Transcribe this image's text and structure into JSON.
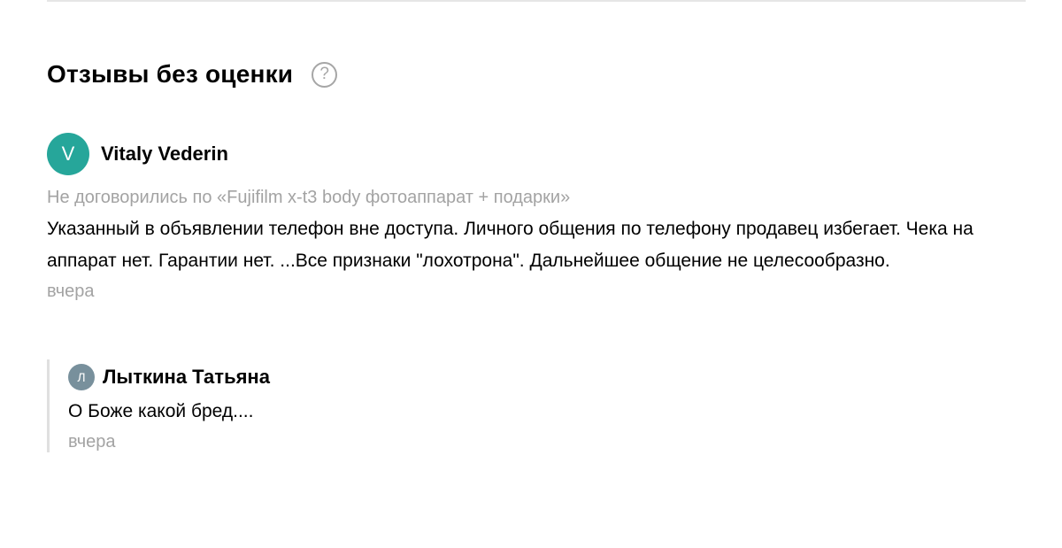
{
  "colors": {
    "avatar_primary": "#26a69a",
    "avatar_reply": "#78909c",
    "muted_text": "#a3a3a3",
    "divider": "#e6e6e6"
  },
  "section": {
    "title": "Отзывы без оценки",
    "help_icon": "?"
  },
  "review": {
    "avatar_letter": "V",
    "author": "Vitaly Vederin",
    "deal": "Не договорились по «Fujifilm x-t3 body фотоаппарат + подарки»",
    "text": "Указанный в объявлении телефон вне доступа. Личного общения по телефону продавец избегает. Чека на аппарат нет. Гарантии нет. ...Все признаки \"лохотрона\". Дальнейшее общение не целесообразно.",
    "date": "вчера"
  },
  "reply": {
    "avatar_letter": "Л",
    "author": "Лыткина Татьяна",
    "text": "О Боже какой бред....",
    "date": "вчера"
  }
}
